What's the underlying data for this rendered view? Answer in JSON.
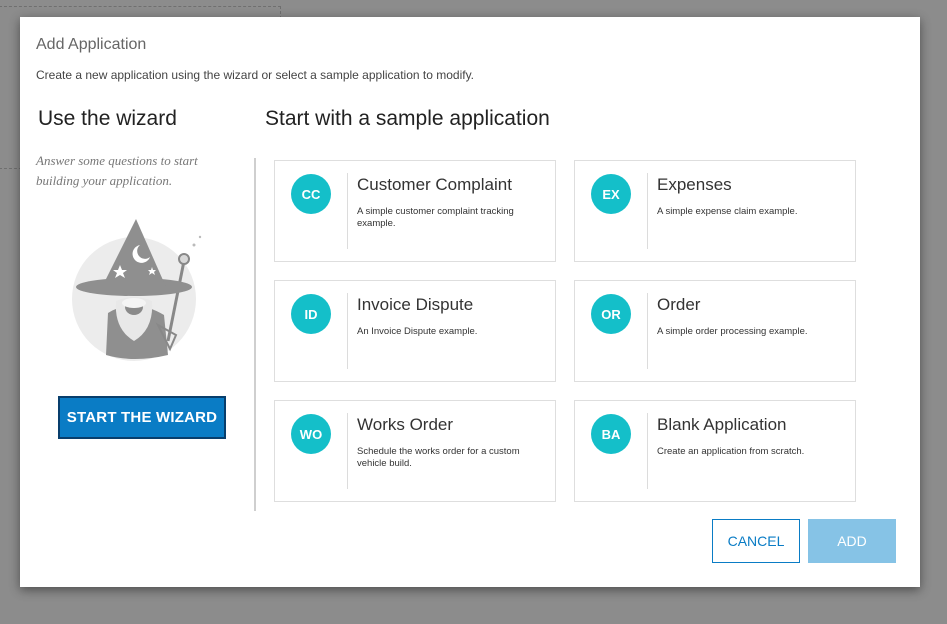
{
  "dialog": {
    "title": "Add Application",
    "subtitle": "Create a new application using the wizard or select a sample application to modify."
  },
  "wizard": {
    "heading": "Use the wizard",
    "description": "Answer some questions to start building your application.",
    "button_label": "START THE WIZARD",
    "illustration_icon": "wizard-icon"
  },
  "samples": {
    "heading": "Start with a sample application",
    "cards": [
      {
        "badge": "CC",
        "title": "Customer Complaint",
        "description": "A simple customer complaint tracking example."
      },
      {
        "badge": "EX",
        "title": "Expenses",
        "description": "A simple expense claim example."
      },
      {
        "badge": "ID",
        "title": "Invoice Dispute",
        "description": "An Invoice Dispute example."
      },
      {
        "badge": "OR",
        "title": "Order",
        "description": "A simple order processing example."
      },
      {
        "badge": "WO",
        "title": "Works Order",
        "description": "Schedule the works order for a custom vehicle build."
      },
      {
        "badge": "BA",
        "title": "Blank Application",
        "description": "Create an application from scratch."
      }
    ]
  },
  "footer": {
    "cancel_label": "CANCEL",
    "add_label": "ADD"
  },
  "colors": {
    "accent": "#0a7cc5",
    "badge": "#14bfc9",
    "add_disabled": "#86c3e6",
    "overlay": "#8c8c8c"
  }
}
